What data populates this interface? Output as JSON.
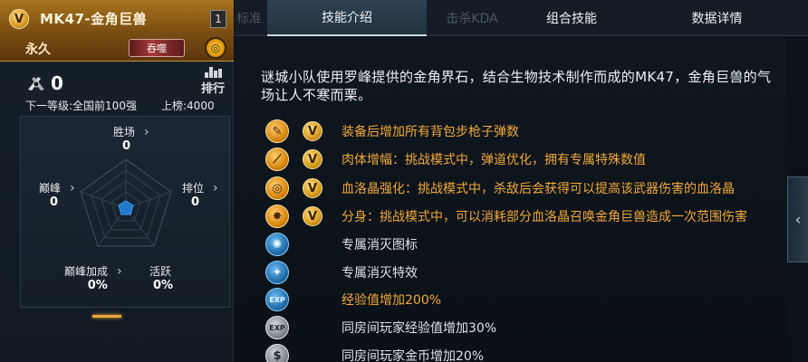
{
  "weapon": {
    "badge": "V",
    "name": "MK47-金角巨兽",
    "count": "1",
    "duration": "永久",
    "tag": "吞噬",
    "medal_icon": "gold-medal-icon"
  },
  "stats_header": {
    "kills": "0",
    "rank_label": "排行",
    "next_level": "下一等级:全国前100强",
    "on_board": "上榜:4000"
  },
  "stats": {
    "wins": {
      "label": "胜场",
      "value": "0"
    },
    "rank": {
      "label": "排位",
      "value": "0"
    },
    "peak": {
      "label": "巅峰",
      "value": "0"
    },
    "peak_bonus": {
      "label": "巅峰加成",
      "value": "0%"
    },
    "active": {
      "label": "活跃",
      "value": "0%"
    }
  },
  "tabs": {
    "dim1": "标准",
    "skill": "技能介绍",
    "dim2": "击杀KDA",
    "combo": "组合技能",
    "details": "数据详情"
  },
  "description": "谜城小队使用罗峰提供的金角界石，结合生物技术制作而成的MK47，金角巨兽的气场让人不寒而栗。",
  "skills": [
    {
      "icon": "rifle-icon",
      "glyph": "✎",
      "style": "gold",
      "v": true,
      "text": "装备后增加所有背包步枪子弹数",
      "text_style": "gold"
    },
    {
      "icon": "claw-icon",
      "glyph": "⟋",
      "style": "gold",
      "v": true,
      "text": "肉体增幅：挑战模式中，弹道优化，拥有专属特殊数值",
      "text_style": "gold"
    },
    {
      "icon": "crosshair-icon",
      "glyph": "◎",
      "style": "gold",
      "v": true,
      "text": "血洛晶强化：挑战模式中，杀敌后会获得可以提高该武器伤害的血洛晶",
      "text_style": "gold"
    },
    {
      "icon": "burst-icon",
      "glyph": "✸",
      "style": "gold",
      "v": true,
      "text": "分身：挑战模式中，可以消耗部分血洛晶召唤金角巨兽造成一次范围伤害",
      "text_style": "gold"
    },
    {
      "icon": "kill-emblem-icon",
      "glyph": "✺",
      "style": "blue",
      "v": false,
      "text": "专属消灭图标",
      "text_style": "plain"
    },
    {
      "icon": "kill-effect-icon",
      "glyph": "✦",
      "style": "blue",
      "v": false,
      "text": "专属消灭特效",
      "text_style": "plain"
    },
    {
      "icon": "exp-icon",
      "glyph": "EXP",
      "style": "blue",
      "v": false,
      "text": "经验值增加200%",
      "text_style": "gold"
    },
    {
      "icon": "room-exp-icon",
      "glyph": "EXP",
      "style": "grey",
      "v": false,
      "text": "同房间玩家经验值增加30%",
      "text_style": "plain"
    },
    {
      "icon": "room-coin-icon",
      "glyph": "$",
      "style": "grey",
      "v": false,
      "text": "同房间玩家金币增加20%",
      "text_style": "plain"
    }
  ],
  "colors": {
    "accent_gold": "#f2a93b",
    "header_gold": "#a8741e",
    "background": "#0b1219"
  }
}
